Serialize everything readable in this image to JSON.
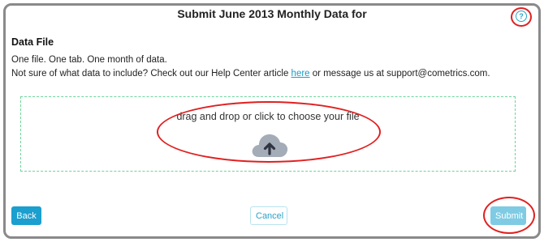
{
  "dialog": {
    "title": "Submit June 2013 Monthly Data for",
    "help_icon": "question-circle-icon"
  },
  "section": {
    "title": "Data File",
    "line1": "One file. One tab. One month of data.",
    "line2_before": "Not sure of what data to include? Check out our Help Center article ",
    "line2_link": "here",
    "line2_after": " or message us at support@cometrics.com."
  },
  "dropzone": {
    "text": "drag and drop or click to choose your file",
    "icon": "cloud-upload-icon"
  },
  "buttons": {
    "back": "Back",
    "cancel": "Cancel",
    "submit": "Submit"
  },
  "colors": {
    "accent": "#1a9fcf",
    "submit_disabled": "#7fcbe3",
    "dropzone_border": "#6cd49b",
    "annotation": "#e02020"
  }
}
